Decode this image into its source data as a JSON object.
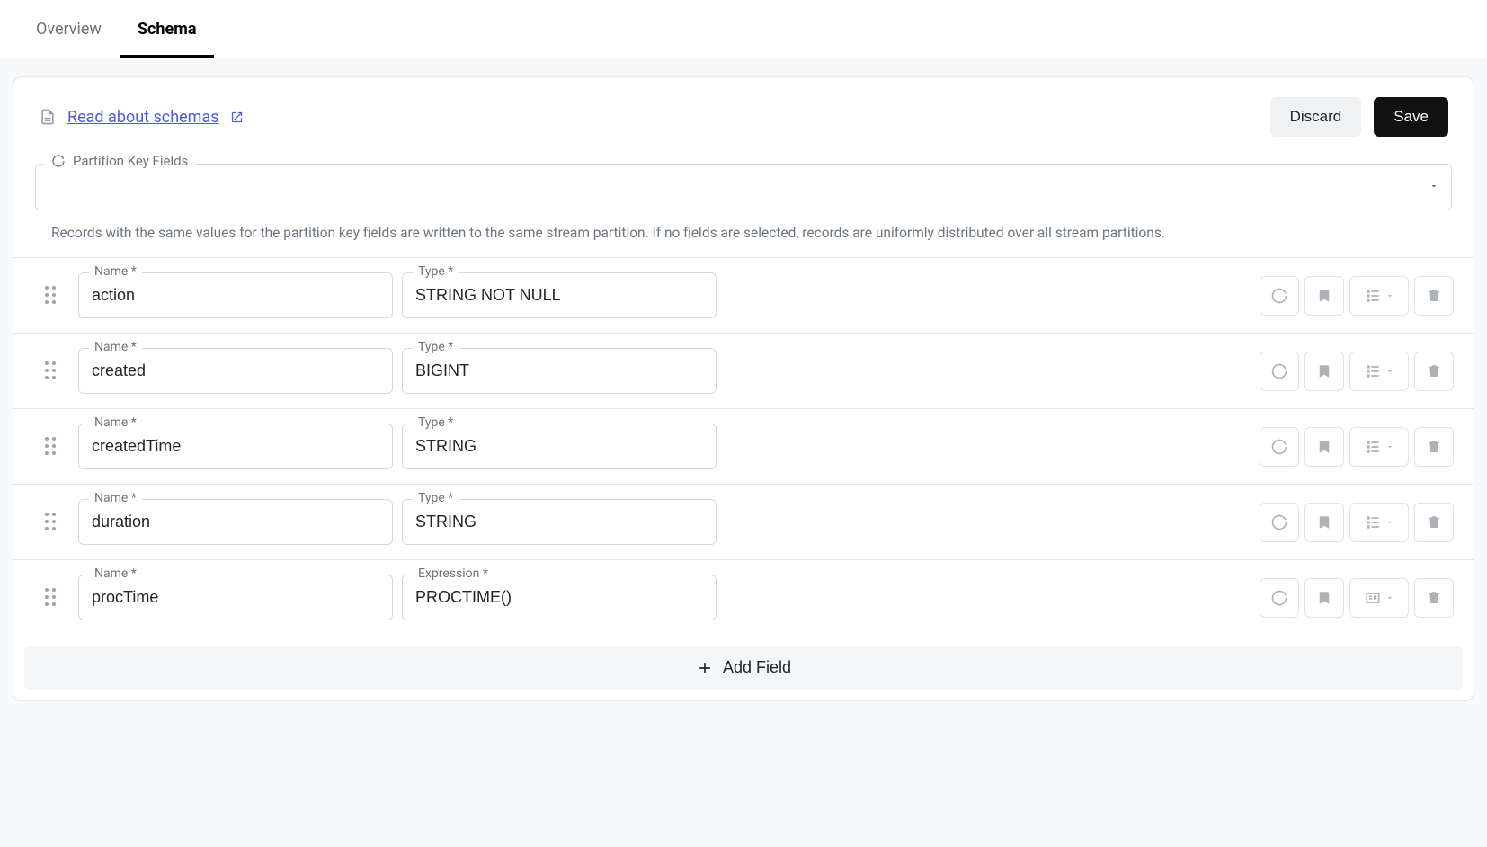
{
  "tabs": {
    "overview": "Overview",
    "schema": "Schema"
  },
  "header": {
    "doc_link_text": "Read about schemas",
    "discard_label": "Discard",
    "save_label": "Save"
  },
  "partition": {
    "legend": "Partition Key Fields",
    "value": "",
    "helper": "Records with the same values for the partition key fields are written to the same stream partition. If no fields are selected, records are uniformly distributed over all stream partitions."
  },
  "labels": {
    "name": "Name *",
    "type": "Type *",
    "expression": "Expression *",
    "add_field": "Add Field"
  },
  "fields": [
    {
      "name": "action",
      "secondLabel": "type",
      "second": "STRING NOT NULL",
      "thirdIcon": "tree"
    },
    {
      "name": "created",
      "secondLabel": "type",
      "second": "BIGINT",
      "thirdIcon": "tree"
    },
    {
      "name": "createdTime",
      "secondLabel": "type",
      "second": "STRING",
      "thirdIcon": "tree"
    },
    {
      "name": "duration",
      "secondLabel": "type",
      "second": "STRING",
      "thirdIcon": "tree"
    },
    {
      "name": "procTime",
      "secondLabel": "expression",
      "second": "PROCTIME()",
      "thirdIcon": "computed"
    }
  ]
}
